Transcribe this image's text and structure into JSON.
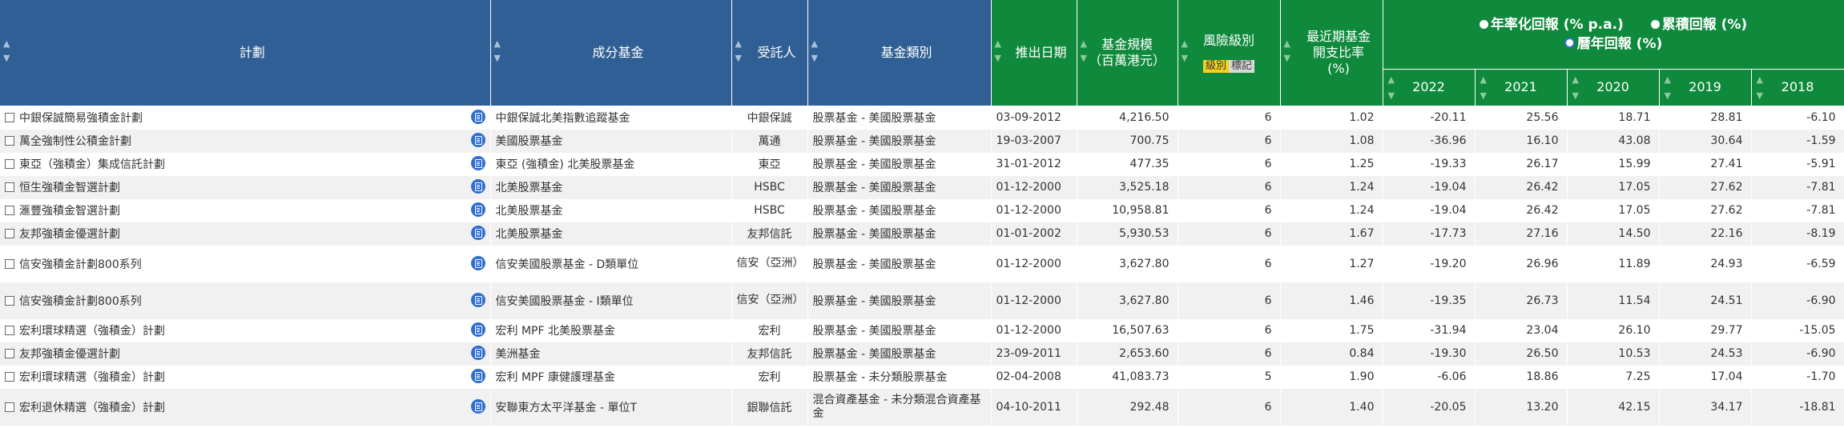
{
  "headers": {
    "scheme": "計劃",
    "fund": "成分基金",
    "trustee": "受託人",
    "category": "基金類別",
    "launch": "推出日期",
    "size": "基金規模\n（百萬港元）",
    "risk": "風險級別",
    "risk_tag_a": "級別",
    "risk_tag_b": "標記",
    "fer": "最近期基金\n開支比率 (%)",
    "return_mode_annualized": "年率化回報 (% p.a.)",
    "return_mode_cumulative": "累積回報 (%)",
    "return_mode_calendar": "曆年回報 (%)",
    "years": [
      "2022",
      "2021",
      "2020",
      "2019",
      "2018"
    ]
  },
  "rows": [
    {
      "scheme": "中銀保誠簡易強積金計劃",
      "fund": "中銀保誠北美指數追蹤基金",
      "trustee": "中銀保誠",
      "category": "股票基金 - 美國股票基金",
      "launch": "03-09-2012",
      "size": "4,216.50",
      "risk": "6",
      "fer": "1.02",
      "r": [
        "-20.11",
        "25.56",
        "18.71",
        "28.81",
        "-6.10"
      ]
    },
    {
      "scheme": "萬全強制性公積金計劃",
      "fund": "美國股票基金",
      "trustee": "萬通",
      "category": "股票基金 - 美國股票基金",
      "launch": "19-03-2007",
      "size": "700.75",
      "risk": "6",
      "fer": "1.08",
      "r": [
        "-36.96",
        "16.10",
        "43.08",
        "30.64",
        "-1.59"
      ]
    },
    {
      "scheme": "東亞（強積金）集成信託計劃",
      "fund": "東亞 (強積金) 北美股票基金",
      "trustee": "東亞",
      "category": "股票基金 - 美國股票基金",
      "launch": "31-01-2012",
      "size": "477.35",
      "risk": "6",
      "fer": "1.25",
      "r": [
        "-19.33",
        "26.17",
        "15.99",
        "27.41",
        "-5.91"
      ]
    },
    {
      "scheme": "恒生強積金智選計劃",
      "fund": "北美股票基金",
      "trustee": "HSBC",
      "category": "股票基金 - 美國股票基金",
      "launch": "01-12-2000",
      "size": "3,525.18",
      "risk": "6",
      "fer": "1.24",
      "r": [
        "-19.04",
        "26.42",
        "17.05",
        "27.62",
        "-7.81"
      ]
    },
    {
      "scheme": "滙豐強積金智選計劃",
      "fund": "北美股票基金",
      "trustee": "HSBC",
      "category": "股票基金 - 美國股票基金",
      "launch": "01-12-2000",
      "size": "10,958.81",
      "risk": "6",
      "fer": "1.24",
      "r": [
        "-19.04",
        "26.42",
        "17.05",
        "27.62",
        "-7.81"
      ]
    },
    {
      "scheme": "友邦強積金優選計劃",
      "fund": "北美股票基金",
      "trustee": "友邦信託",
      "category": "股票基金 - 美國股票基金",
      "launch": "01-01-2002",
      "size": "5,930.53",
      "risk": "6",
      "fer": "1.67",
      "r": [
        "-17.73",
        "27.16",
        "14.50",
        "22.16",
        "-8.19"
      ]
    },
    {
      "scheme": "信安強積金計劃800系列",
      "fund": "信安美國股票基金 - D類單位",
      "trustee": "信安（亞洲）",
      "category": "股票基金 - 美國股票基金",
      "launch": "01-12-2000",
      "size": "3,627.80",
      "risk": "6",
      "fer": "1.27",
      "r": [
        "-19.20",
        "26.96",
        "11.89",
        "24.93",
        "-6.59"
      ]
    },
    {
      "scheme": "信安強積金計劃800系列",
      "fund": "信安美國股票基金 - I類單位",
      "trustee": "信安（亞洲）",
      "category": "股票基金 - 美國股票基金",
      "launch": "01-12-2000",
      "size": "3,627.80",
      "risk": "6",
      "fer": "1.46",
      "r": [
        "-19.35",
        "26.73",
        "11.54",
        "24.51",
        "-6.90"
      ]
    },
    {
      "scheme": "宏利環球精選（強積金）計劃",
      "fund": "宏利 MPF 北美股票基金",
      "trustee": "宏利",
      "category": "股票基金 - 美國股票基金",
      "launch": "01-12-2000",
      "size": "16,507.63",
      "risk": "6",
      "fer": "1.75",
      "r": [
        "-31.94",
        "23.04",
        "26.10",
        "29.77",
        "-15.05"
      ]
    },
    {
      "scheme": "友邦強積金優選計劃",
      "fund": "美洲基金",
      "trustee": "友邦信託",
      "category": "股票基金 - 美國股票基金",
      "launch": "23-09-2011",
      "size": "2,653.60",
      "risk": "6",
      "fer": "0.84",
      "r": [
        "-19.30",
        "26.50",
        "10.53",
        "24.53",
        "-6.90"
      ]
    },
    {
      "scheme": "宏利環球精選（強積金）計劃",
      "fund": "宏利 MPF 康健護理基金",
      "trustee": "宏利",
      "category": "股票基金 - 未分類股票基金",
      "launch": "02-04-2008",
      "size": "41,083.73",
      "risk": "5",
      "fer": "1.90",
      "r": [
        "-6.06",
        "18.86",
        "7.25",
        "17.04",
        "-1.70"
      ]
    },
    {
      "scheme": "宏利退休精選（強積金）計劃",
      "fund": "安聯東方太平洋基金 - 單位T",
      "trustee": "銀聯信託",
      "category": "混合資產基金 - 未分類混合資產基金",
      "launch": "04-10-2011",
      "size": "292.48",
      "risk": "6",
      "fer": "1.40",
      "r": [
        "-20.05",
        "13.20",
        "42.15",
        "34.17",
        "-18.81"
      ]
    }
  ]
}
